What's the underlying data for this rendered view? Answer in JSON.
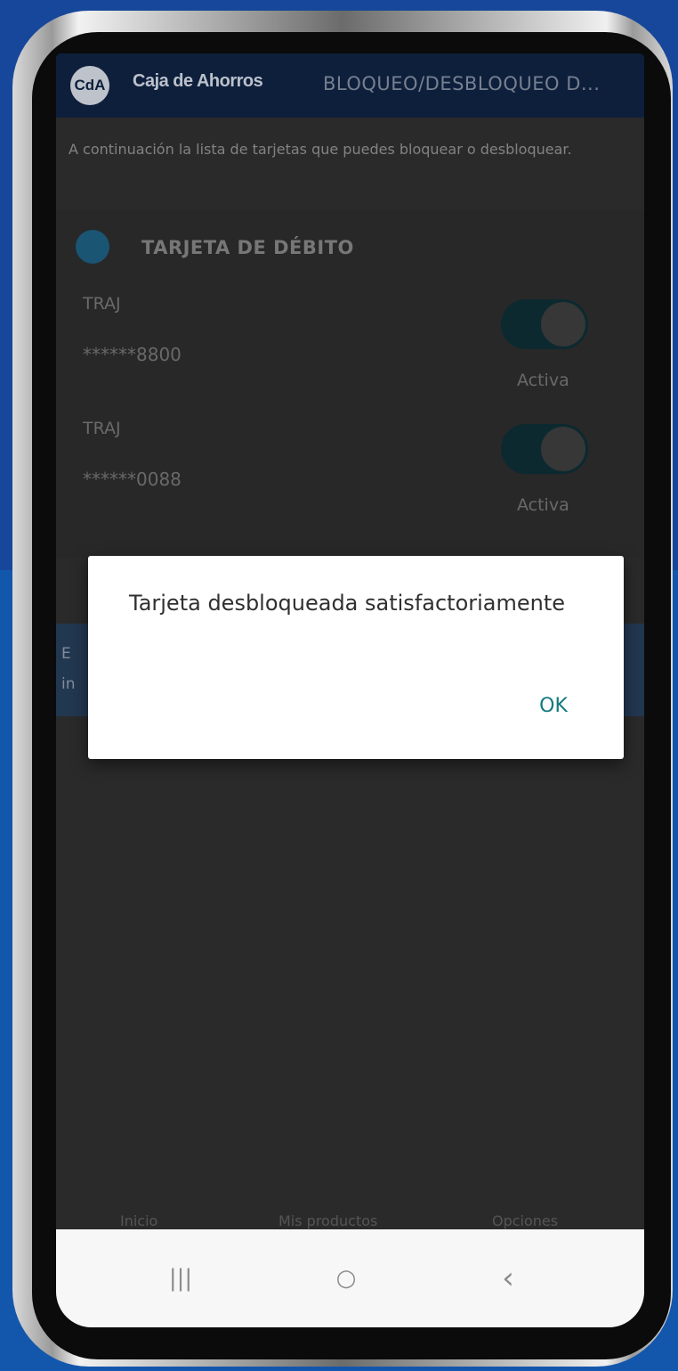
{
  "app": {
    "logo_text": "CdA",
    "brand": "Caja de Ahorros",
    "title": "BLOQUEO/DESBLOQUEO D..."
  },
  "intro": "A continuación la lista de tarjetas que puedes bloquear o desbloquear.",
  "section": {
    "title": "TARJETA DE DÉBITO",
    "cards": [
      {
        "label": "TRAJ",
        "number": "******8800",
        "status": "Activa",
        "toggle_on": true
      },
      {
        "label": "TRAJ",
        "number": "******0088",
        "status": "Activa",
        "toggle_on": true
      }
    ]
  },
  "info_strip": {
    "line1": "E",
    "line2": "in"
  },
  "bottom_tabs": [
    "Inicio",
    "Mis productos",
    "Opciones"
  ],
  "dialog": {
    "message": "Tarjeta desbloqueada satisfactoriamente",
    "ok_label": "OK"
  },
  "navbar": {
    "recents": "|||",
    "home": "○",
    "back": "‹"
  }
}
